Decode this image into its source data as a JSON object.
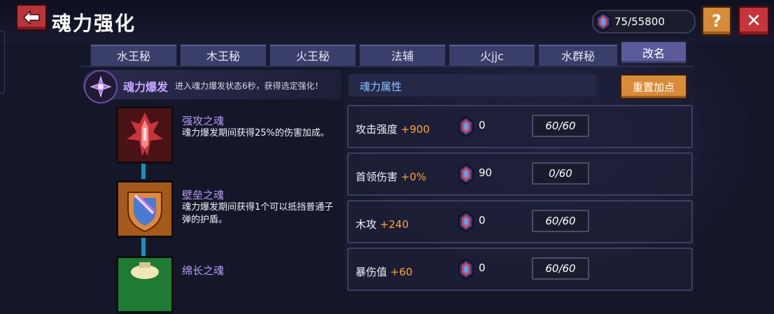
{
  "header": {
    "title": "魂力强化",
    "crystals": "75/55800",
    "help_label": "?",
    "close_label": "✕"
  },
  "tabs": [
    "水王秘",
    "木王秘",
    "火王秘",
    "法辅",
    "火jjc",
    "水群秘"
  ],
  "rename_label": "改名",
  "burst": {
    "title": "魂力爆发",
    "desc": "进入魂力爆发状态6秒，获得选定强化！"
  },
  "skills": [
    {
      "name": "强攻之魂",
      "desc": "魂力爆发期间获得25%的伤害加成。"
    },
    {
      "name": "壁垒之魂",
      "desc": "魂力爆发期间获得1个可以抵挡普通子弹的护盾。"
    },
    {
      "name": "绵长之魂",
      "desc": ""
    }
  ],
  "attributes": {
    "title": "魂力属性",
    "reset_label": "重置加点",
    "rows": [
      {
        "label": "攻击强度",
        "bonus": "+900",
        "cost": "0",
        "progress": "60/60"
      },
      {
        "label": "首领伤害",
        "bonus": "+0%",
        "cost": "90",
        "progress": "0/60"
      },
      {
        "label": "木攻",
        "bonus": "+240",
        "cost": "0",
        "progress": "60/60"
      },
      {
        "label": "暴伤值",
        "bonus": "+60",
        "cost": "0",
        "progress": "60/60"
      }
    ]
  },
  "colors": {
    "accent_orange": "#ffa633",
    "skill_name": "#b99cf4",
    "attr_title": "#8fc6ff"
  }
}
